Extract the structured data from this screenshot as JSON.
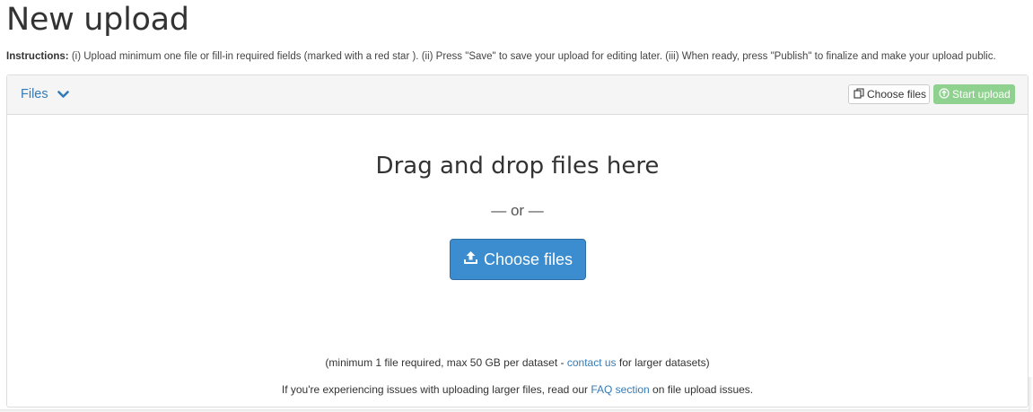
{
  "page": {
    "title": "New upload"
  },
  "instructions": {
    "label": "Instructions:",
    "text": " (i) Upload minimum one file or fill-in required fields (marked with a red star ). (ii) Press \"Save\" to save your upload for editing later. (iii) When ready, press \"Publish\" to finalize and make your upload public."
  },
  "files_panel": {
    "toggle_label": "Files",
    "choose_files_label": "Choose files",
    "start_upload_label": "Start upload",
    "drop_title": "Drag and drop files here",
    "or_text": "— or —",
    "main_choose_label": "Choose files",
    "note_prefix": "(minimum 1 file required, max 50 GB per dataset - ",
    "contact_link": "contact us",
    "note_suffix": " for larger datasets)",
    "faq_prefix": "If you're experiencing issues with uploading larger files, read our ",
    "faq_link": "FAQ section",
    "faq_suffix": " on file upload issues."
  },
  "icons": {
    "toggle": "chevron-down-icon",
    "choose_small": "copy-icon",
    "start": "circle-arrow-up-icon",
    "main_choose": "upload-icon"
  },
  "colors": {
    "link": "#337ab7",
    "primary": "#3b8dd0",
    "success_disabled": "#8fd18f"
  }
}
